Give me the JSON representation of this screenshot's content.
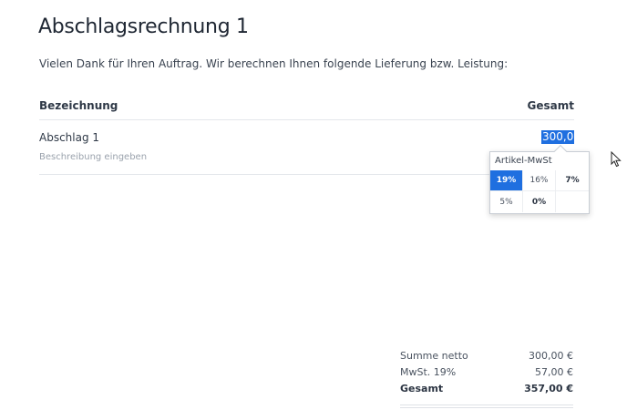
{
  "document": {
    "title": "Abschlagsrechnung 1",
    "intro": "Vielen Dank für Ihren Auftrag. Wir berechnen Ihnen folgende Lieferung bzw. Leistung:"
  },
  "table": {
    "columns": [
      "Bezeichnung",
      "Gesamt"
    ],
    "rows": [
      {
        "name": "Abschlag 1",
        "description_placeholder": "Beschreibung eingeben",
        "amount": "300,00"
      }
    ]
  },
  "vat_popover": {
    "title": "Artikel-MwSt",
    "options": [
      "19%",
      "16%",
      "7%",
      "5%",
      "0%"
    ],
    "selected": "19%"
  },
  "totals": {
    "net_label": "Summe netto",
    "net_value": "300,00 €",
    "vat_label": "MwSt. 19%",
    "vat_value": "57,00 €",
    "gross_label": "Gesamt",
    "gross_value": "357,00 €"
  },
  "colors": {
    "accent": "#1f6fe0",
    "text": "#2b3442",
    "muted": "#9aa2ac"
  },
  "icons": {
    "cursor": "mouse-pointer-icon"
  }
}
